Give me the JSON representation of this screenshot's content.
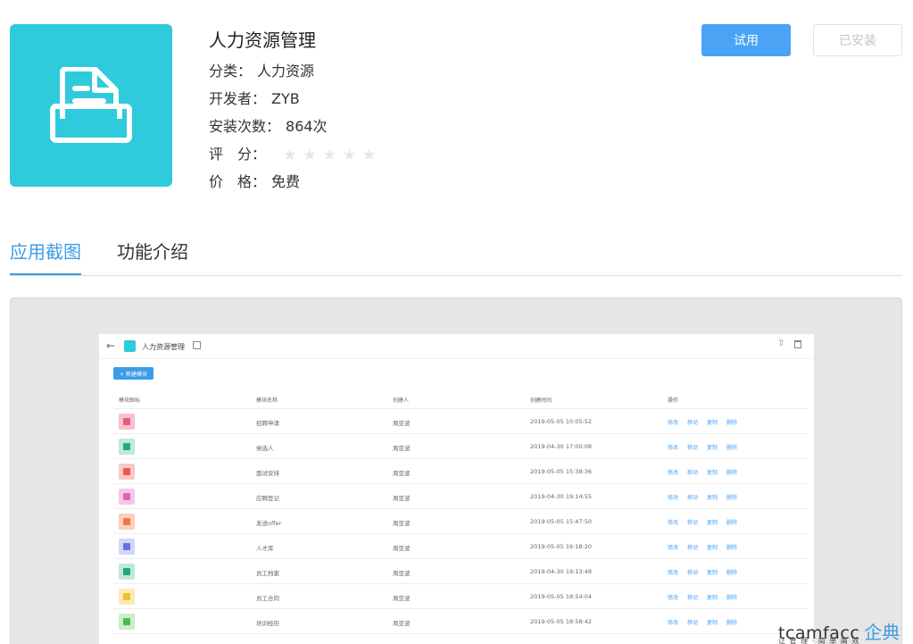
{
  "app": {
    "title": "人力资源管理",
    "category_label": "分类：",
    "category_value": "人力资源",
    "developer_label": "开发者：",
    "developer_value": "ZYB",
    "installs_label": "安装次数：",
    "installs_value": "864次",
    "rating_label": "评　分：",
    "rating_value": 0,
    "rating_max": 5,
    "price_label": "价　格：",
    "price_value": "免费",
    "icon": "document-tray-icon",
    "icon_color": "#2fcadb"
  },
  "buttons": {
    "try": "试用",
    "installed": "已安装",
    "accent": "#4aa3f5"
  },
  "tabs": [
    {
      "label": "应用截图",
      "active": true
    },
    {
      "label": "功能介绍",
      "active": false
    }
  ],
  "screenshot": {
    "title": "人力资源管理",
    "new_button": "+ 新建模块",
    "columns": [
      "模块图标",
      "模块名称",
      "创建人",
      "创建时间",
      "操作"
    ],
    "actions": [
      "修改",
      "移动",
      "复制",
      "删除"
    ],
    "rows": [
      {
        "name": "招聘申请",
        "creator": "周亚波",
        "time": "2019-05-05 10:05:52",
        "color": "#f6c2cf",
        "inner": "#e95a7f"
      },
      {
        "name": "候选人",
        "creator": "周亚波",
        "time": "2019-04-30 17:00:08",
        "color": "#bfe8df",
        "inner": "#26a98a"
      },
      {
        "name": "面试安排",
        "creator": "周亚波",
        "time": "2019-05-05 15:38:36",
        "color": "#f9c9c6",
        "inner": "#ec5a51"
      },
      {
        "name": "应聘登记",
        "creator": "周亚波",
        "time": "2019-04-30 19:14:55",
        "color": "#f4c8e3",
        "inner": "#dc64b0"
      },
      {
        "name": "发送offer",
        "creator": "周亚波",
        "time": "2019-05-05 15:47:50",
        "color": "#fbd0bc",
        "inner": "#f07a43"
      },
      {
        "name": "人才库",
        "creator": "周亚波",
        "time": "2019-05-05 16:18:20",
        "color": "#d4d5f7",
        "inner": "#6d70e0"
      },
      {
        "name": "员工档案",
        "creator": "周亚波",
        "time": "2019-04-30 19:13:48",
        "color": "#bfe8dc",
        "inner": "#23a57e"
      },
      {
        "name": "员工合同",
        "creator": "周亚波",
        "time": "2019-05-05 18:54:04",
        "color": "#fcebb4",
        "inner": "#f0bf2a"
      },
      {
        "name": "培训经历",
        "creator": "周亚波",
        "time": "2019-05-05 18:58:42",
        "color": "#cdeecd",
        "inner": "#4cbb4c"
      }
    ]
  },
  "watermark": {
    "brand": "tcamfacc",
    "brand_cn": "企典",
    "slogan": "让 管 理 · 简 单 高 效"
  }
}
